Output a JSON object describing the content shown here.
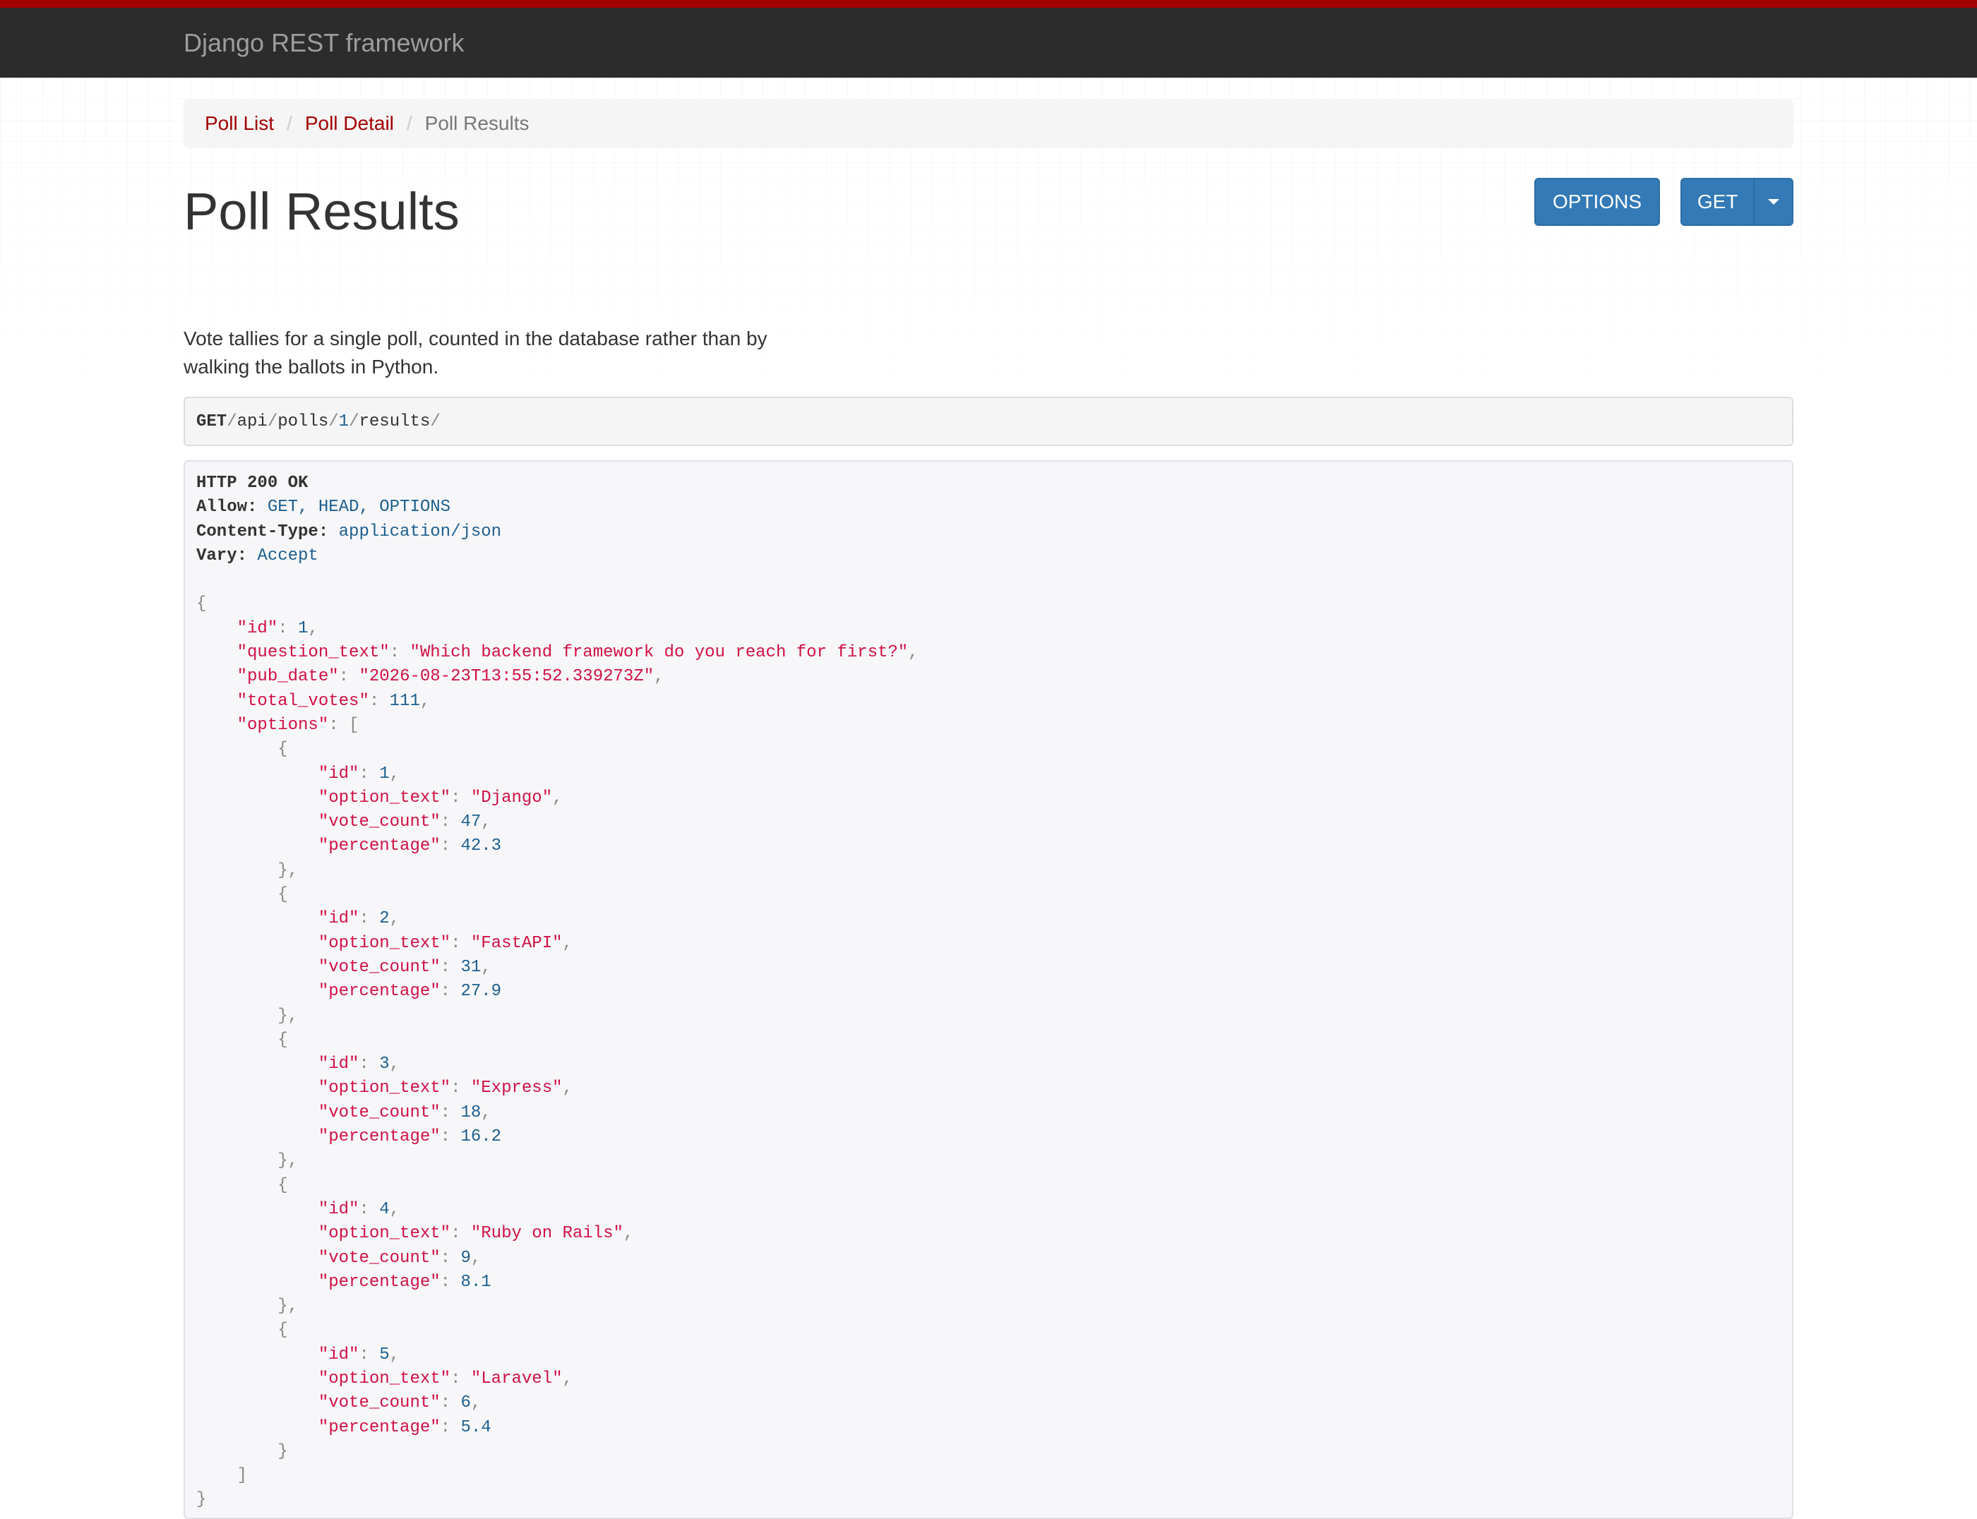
{
  "navbar": {
    "brand": "Django REST framework"
  },
  "breadcrumb": {
    "items": [
      {
        "label": "Poll List"
      },
      {
        "label": "Poll Detail"
      }
    ],
    "active": "Poll Results",
    "separator": "/"
  },
  "page": {
    "title": "Poll Results",
    "description": "Vote tallies for a single poll, counted in the database rather than by walking the ballots in Python."
  },
  "buttons": {
    "options_label": "OPTIONS",
    "get_label": "GET"
  },
  "request": {
    "method": "GET",
    "path": [
      {
        "text": "/",
        "kind": "pun"
      },
      {
        "text": "api",
        "kind": "plain"
      },
      {
        "text": "/",
        "kind": "pun"
      },
      {
        "text": "polls",
        "kind": "plain"
      },
      {
        "text": "/",
        "kind": "pun"
      },
      {
        "text": "1",
        "kind": "num"
      },
      {
        "text": "/",
        "kind": "pun"
      },
      {
        "text": "results",
        "kind": "plain"
      },
      {
        "text": "/",
        "kind": "pun"
      }
    ]
  },
  "response": {
    "status_line": "HTTP 200 OK",
    "headers": [
      {
        "name": "Allow:",
        "value": "GET, HEAD, OPTIONS"
      },
      {
        "name": "Content-Type:",
        "value": "application/json"
      },
      {
        "name": "Vary:",
        "value": "Accept"
      }
    ],
    "body": {
      "id": 1,
      "question_text": "Which backend framework do you reach for first?",
      "pub_date": "2026-08-23T13:55:52.339273Z",
      "total_votes": 111,
      "options": [
        {
          "id": 1,
          "option_text": "Django",
          "vote_count": 47,
          "percentage": 42.3
        },
        {
          "id": 2,
          "option_text": "FastAPI",
          "vote_count": 31,
          "percentage": 27.9
        },
        {
          "id": 3,
          "option_text": "Express",
          "vote_count": 18,
          "percentage": 16.2
        },
        {
          "id": 4,
          "option_text": "Ruby on Rails",
          "vote_count": 9,
          "percentage": 8.1
        },
        {
          "id": 5,
          "option_text": "Laravel",
          "vote_count": 6,
          "percentage": 5.4
        }
      ]
    }
  },
  "colors": {
    "accent_red": "#a30000",
    "navbar_bg": "#2c2c2c",
    "button_blue": "#337ab7",
    "json_string": "#d01044",
    "json_number": "#1d5f8e"
  }
}
